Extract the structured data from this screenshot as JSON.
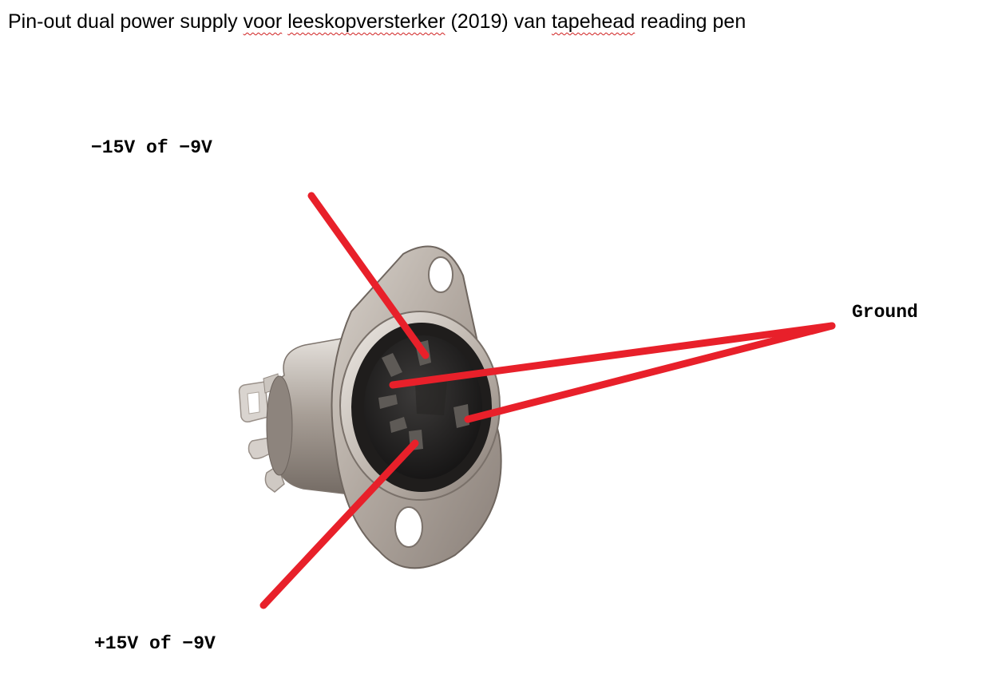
{
  "document": {
    "title_parts": [
      "Pin-out dual power supply ",
      "voor",
      " ",
      "leeskopversterker",
      " (2019) van ",
      "tapehead",
      " reading pen"
    ]
  },
  "labels": {
    "minus": "−15V of −9V",
    "ground": "Ground",
    "plus": "+15V of −9V"
  },
  "colors": {
    "annotation_line": "#e8202a",
    "text": "#000000",
    "spellcheck_underline": "#d02020"
  },
  "connector": {
    "type": "5-pin DIN panel socket",
    "icon": "din-socket-photo"
  }
}
